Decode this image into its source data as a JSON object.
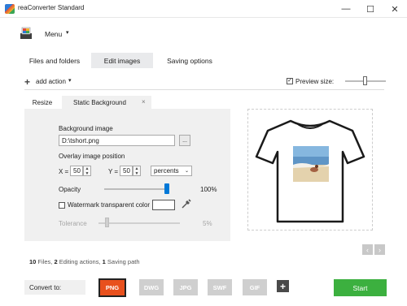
{
  "window": {
    "title": "reaConverter Standard",
    "controls": [
      "—",
      "☐",
      "✕"
    ]
  },
  "menu": {
    "label": "Menu",
    "caret": "▾"
  },
  "tabs": [
    {
      "label": "Files and folders",
      "active": false
    },
    {
      "label": "Edit images",
      "active": true
    },
    {
      "label": "Saving options",
      "active": false
    }
  ],
  "toolbar": {
    "add_action_label": "add action",
    "add_icon": "+",
    "caret": "▾",
    "preview_size_label": "Preview size:",
    "preview_checked": true,
    "check_mark": "✓"
  },
  "subtabs": [
    {
      "label": "Resize",
      "active": false
    },
    {
      "label": "Static Background",
      "active": true
    }
  ],
  "subtab_close": "×",
  "panel": {
    "background_image_label": "Background image",
    "background_image_value": "D:\\tshort.png",
    "browse_label": "...",
    "overlay_position_label": "Overlay image position",
    "x_label": "X =",
    "x_value": "50",
    "y_label": "Y =",
    "y_value": "50",
    "spin_up": "▲",
    "spin_down": "▼",
    "unit_value": "percents",
    "unit_caret": "⌄",
    "opacity_label": "Opacity",
    "opacity_value": "100%",
    "opacity_level": 1.0,
    "watermark_label": "Watermark transparent color",
    "watermark_checked": false,
    "tolerance_label": "Tolerance",
    "tolerance_value": "5%",
    "tolerance_level": 0.05
  },
  "preview": {
    "prev": "‹",
    "next": "›"
  },
  "summary": {
    "files_count": "10",
    "files_label": " Files, ",
    "editing_count": "2",
    "editing_label": " Editing actions, ",
    "saving_count": "1",
    "saving_label": " Saving path"
  },
  "bottom": {
    "convert_to_label": "Convert to:",
    "formats": [
      {
        "label": "PNG",
        "selected": true
      },
      {
        "label": "DWG",
        "selected": false
      },
      {
        "label": "JPG",
        "selected": false
      },
      {
        "label": "SWF",
        "selected": false
      },
      {
        "label": "GIF",
        "selected": false
      }
    ],
    "add_format": "+",
    "start_label": "Start"
  },
  "colors": {
    "accent_blue": "#0078d7",
    "selected_format": "#e8501d",
    "start_green": "#3cb03f",
    "inactive_format": "#cfcfcf"
  }
}
